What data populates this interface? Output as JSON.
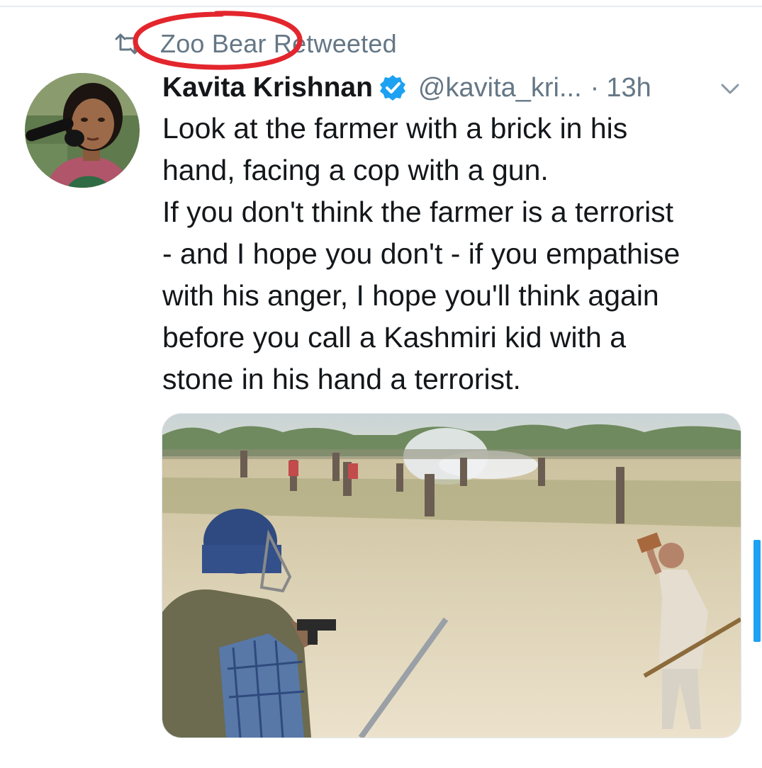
{
  "context": {
    "label": "Zoo Bear Retweeted",
    "icon": "retweet-icon"
  },
  "tweet": {
    "display_name": "Kavita Krishnan",
    "verified": true,
    "handle": "@kavita_kri...",
    "separator": "·",
    "time": "13h",
    "text": "Look at the farmer with a brick in his\nhand, facing a cop with a gun.\nIf you don't think the farmer is a terrorist\n- and I hope you don't - if you empathise\nwith his anger, I hope you'll think again\nbefore you call a Kashmiri kid with a\nstone in his hand a terrorist."
  },
  "colors": {
    "annotation": "#e3262d",
    "accent": "#1da1f2",
    "secondary_text": "#657786",
    "primary_text": "#14171a"
  },
  "icons": [
    "retweet-icon",
    "verified-badge-icon",
    "chevron-down-icon"
  ]
}
